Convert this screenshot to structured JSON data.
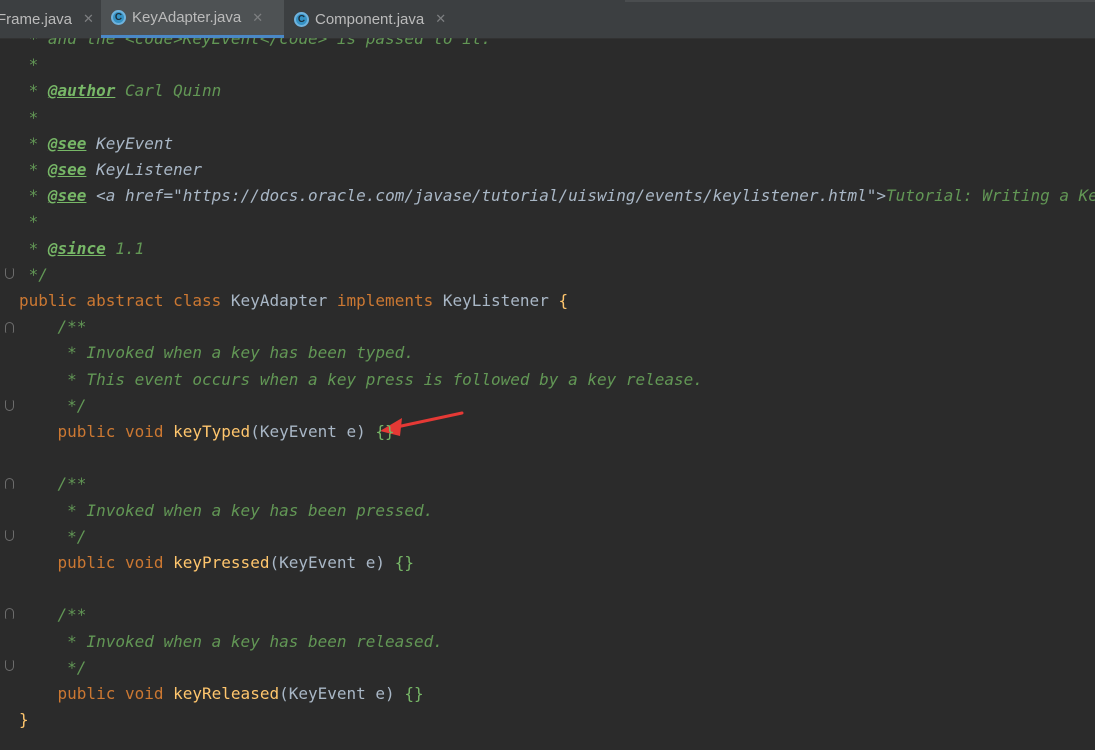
{
  "tabs": [
    {
      "label": "Frame.java",
      "active": false
    },
    {
      "label": "KeyAdapter.java",
      "active": true
    },
    {
      "label": "Component.java",
      "active": false
    }
  ],
  "colors": {
    "keyword": "#cc7832",
    "method": "#ffc66d",
    "doc": "#629755",
    "doc_tag": "#77b767",
    "plain": "#a9b7c6",
    "annotation_arrow": "#e53935"
  },
  "code_lines": [
    [
      [
        "doc",
        " * and the "
      ],
      [
        "doc",
        "<code>"
      ],
      [
        "doc",
        "KeyEvent"
      ],
      [
        "doc",
        "</code>"
      ],
      [
        "doc",
        " is passed to it."
      ]
    ],
    [
      [
        "doc",
        " *"
      ]
    ],
    [
      [
        "doc",
        " * "
      ],
      [
        "tag",
        "@author"
      ],
      [
        "doc",
        " Carl Quinn"
      ]
    ],
    [
      [
        "doc",
        " *"
      ]
    ],
    [
      [
        "doc",
        " * "
      ],
      [
        "tag",
        "@see"
      ],
      [
        "doc",
        " "
      ],
      [
        "ref",
        "KeyEvent"
      ]
    ],
    [
      [
        "doc",
        " * "
      ],
      [
        "tag",
        "@see"
      ],
      [
        "doc",
        " "
      ],
      [
        "ref",
        "KeyListener"
      ]
    ],
    [
      [
        "doc",
        " * "
      ],
      [
        "tag",
        "@see"
      ],
      [
        "doc",
        " "
      ],
      [
        "ref",
        "<a href=\"https://docs.oracle.com/javase/tutorial/uiswing/events/keylistener.html\">"
      ],
      [
        "doc",
        "Tutorial: Writing a Key Listener</a>"
      ]
    ],
    [
      [
        "doc",
        " *"
      ]
    ],
    [
      [
        "doc",
        " * "
      ],
      [
        "tag",
        "@since"
      ],
      [
        "doc",
        " 1.1"
      ]
    ],
    [
      [
        "doc",
        " */"
      ]
    ],
    [
      [
        "kw",
        "public abstract class "
      ],
      [
        "plain",
        "KeyAdapter "
      ],
      [
        "kw",
        "implements "
      ],
      [
        "plain",
        "KeyListener "
      ],
      [
        "brace",
        "{"
      ]
    ],
    [
      [
        "doc",
        "    /**"
      ]
    ],
    [
      [
        "doc",
        "     * Invoked when a key has been typed."
      ]
    ],
    [
      [
        "doc",
        "     * This event occurs when a key press is followed by a key release."
      ]
    ],
    [
      [
        "doc",
        "     */"
      ]
    ],
    [
      [
        "kw",
        "    public void "
      ],
      [
        "method",
        "keyTyped"
      ],
      [
        "plain",
        "(KeyEvent e) "
      ],
      [
        "brace2",
        "{}"
      ]
    ],
    [
      [
        "plain",
        ""
      ]
    ],
    [
      [
        "doc",
        "    /**"
      ]
    ],
    [
      [
        "doc",
        "     * Invoked when a key has been pressed."
      ]
    ],
    [
      [
        "doc",
        "     */"
      ]
    ],
    [
      [
        "kw",
        "    public void "
      ],
      [
        "method",
        "keyPressed"
      ],
      [
        "plain",
        "(KeyEvent e) "
      ],
      [
        "brace2",
        "{}"
      ]
    ],
    [
      [
        "plain",
        ""
      ]
    ],
    [
      [
        "doc",
        "    /**"
      ]
    ],
    [
      [
        "doc",
        "     * Invoked when a key has been released."
      ]
    ],
    [
      [
        "doc",
        "     */"
      ]
    ],
    [
      [
        "kw",
        "    public void "
      ],
      [
        "method",
        "keyReleased"
      ],
      [
        "plain",
        "(KeyEvent e) "
      ],
      [
        "brace2",
        "{}"
      ]
    ],
    [
      [
        "brace",
        "}"
      ]
    ]
  ]
}
